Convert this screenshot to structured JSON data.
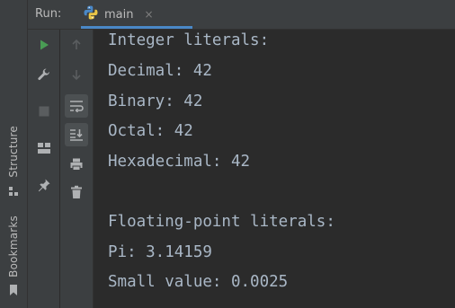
{
  "header": {
    "run_label": "Run:",
    "tab_label": "main",
    "close_glyph": "×"
  },
  "side_panel": {
    "structure_label": "Structure",
    "bookmarks_label": "Bookmarks"
  },
  "console": {
    "lines": [
      "Integer literals:",
      "Decimal: 42",
      "Binary: 42",
      "Octal: 42",
      "Hexadecimal: 42",
      "",
      "Floating-point literals:",
      "Pi: 3.14159",
      "Small value: 0.0025"
    ]
  },
  "colors": {
    "background": "#2b2b2b",
    "panel": "#3c3f41",
    "console_text": "#a9b7c6",
    "run_green": "#499c54",
    "tab_underline": "#4a88c7"
  }
}
